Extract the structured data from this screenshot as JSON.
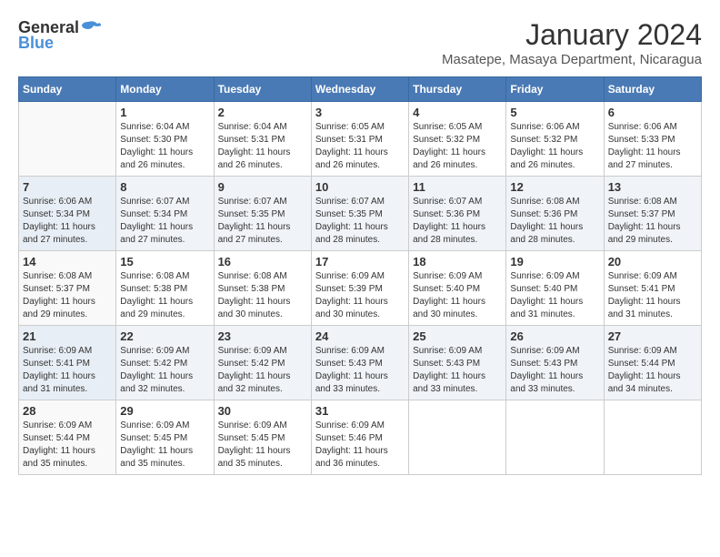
{
  "logo": {
    "general": "General",
    "blue": "Blue"
  },
  "title": "January 2024",
  "location": "Masatepe, Masaya Department, Nicaragua",
  "weekdays": [
    "Sunday",
    "Monday",
    "Tuesday",
    "Wednesday",
    "Thursday",
    "Friday",
    "Saturday"
  ],
  "weeks": [
    [
      {
        "day": "",
        "sunrise": "",
        "sunset": "",
        "daylight": ""
      },
      {
        "day": "1",
        "sunrise": "Sunrise: 6:04 AM",
        "sunset": "Sunset: 5:30 PM",
        "daylight": "Daylight: 11 hours and 26 minutes."
      },
      {
        "day": "2",
        "sunrise": "Sunrise: 6:04 AM",
        "sunset": "Sunset: 5:31 PM",
        "daylight": "Daylight: 11 hours and 26 minutes."
      },
      {
        "day": "3",
        "sunrise": "Sunrise: 6:05 AM",
        "sunset": "Sunset: 5:31 PM",
        "daylight": "Daylight: 11 hours and 26 minutes."
      },
      {
        "day": "4",
        "sunrise": "Sunrise: 6:05 AM",
        "sunset": "Sunset: 5:32 PM",
        "daylight": "Daylight: 11 hours and 26 minutes."
      },
      {
        "day": "5",
        "sunrise": "Sunrise: 6:06 AM",
        "sunset": "Sunset: 5:32 PM",
        "daylight": "Daylight: 11 hours and 26 minutes."
      },
      {
        "day": "6",
        "sunrise": "Sunrise: 6:06 AM",
        "sunset": "Sunset: 5:33 PM",
        "daylight": "Daylight: 11 hours and 27 minutes."
      }
    ],
    [
      {
        "day": "7",
        "sunrise": "Sunrise: 6:06 AM",
        "sunset": "Sunset: 5:34 PM",
        "daylight": "Daylight: 11 hours and 27 minutes."
      },
      {
        "day": "8",
        "sunrise": "Sunrise: 6:07 AM",
        "sunset": "Sunset: 5:34 PM",
        "daylight": "Daylight: 11 hours and 27 minutes."
      },
      {
        "day": "9",
        "sunrise": "Sunrise: 6:07 AM",
        "sunset": "Sunset: 5:35 PM",
        "daylight": "Daylight: 11 hours and 27 minutes."
      },
      {
        "day": "10",
        "sunrise": "Sunrise: 6:07 AM",
        "sunset": "Sunset: 5:35 PM",
        "daylight": "Daylight: 11 hours and 28 minutes."
      },
      {
        "day": "11",
        "sunrise": "Sunrise: 6:07 AM",
        "sunset": "Sunset: 5:36 PM",
        "daylight": "Daylight: 11 hours and 28 minutes."
      },
      {
        "day": "12",
        "sunrise": "Sunrise: 6:08 AM",
        "sunset": "Sunset: 5:36 PM",
        "daylight": "Daylight: 11 hours and 28 minutes."
      },
      {
        "day": "13",
        "sunrise": "Sunrise: 6:08 AM",
        "sunset": "Sunset: 5:37 PM",
        "daylight": "Daylight: 11 hours and 29 minutes."
      }
    ],
    [
      {
        "day": "14",
        "sunrise": "Sunrise: 6:08 AM",
        "sunset": "Sunset: 5:37 PM",
        "daylight": "Daylight: 11 hours and 29 minutes."
      },
      {
        "day": "15",
        "sunrise": "Sunrise: 6:08 AM",
        "sunset": "Sunset: 5:38 PM",
        "daylight": "Daylight: 11 hours and 29 minutes."
      },
      {
        "day": "16",
        "sunrise": "Sunrise: 6:08 AM",
        "sunset": "Sunset: 5:38 PM",
        "daylight": "Daylight: 11 hours and 30 minutes."
      },
      {
        "day": "17",
        "sunrise": "Sunrise: 6:09 AM",
        "sunset": "Sunset: 5:39 PM",
        "daylight": "Daylight: 11 hours and 30 minutes."
      },
      {
        "day": "18",
        "sunrise": "Sunrise: 6:09 AM",
        "sunset": "Sunset: 5:40 PM",
        "daylight": "Daylight: 11 hours and 30 minutes."
      },
      {
        "day": "19",
        "sunrise": "Sunrise: 6:09 AM",
        "sunset": "Sunset: 5:40 PM",
        "daylight": "Daylight: 11 hours and 31 minutes."
      },
      {
        "day": "20",
        "sunrise": "Sunrise: 6:09 AM",
        "sunset": "Sunset: 5:41 PM",
        "daylight": "Daylight: 11 hours and 31 minutes."
      }
    ],
    [
      {
        "day": "21",
        "sunrise": "Sunrise: 6:09 AM",
        "sunset": "Sunset: 5:41 PM",
        "daylight": "Daylight: 11 hours and 31 minutes."
      },
      {
        "day": "22",
        "sunrise": "Sunrise: 6:09 AM",
        "sunset": "Sunset: 5:42 PM",
        "daylight": "Daylight: 11 hours and 32 minutes."
      },
      {
        "day": "23",
        "sunrise": "Sunrise: 6:09 AM",
        "sunset": "Sunset: 5:42 PM",
        "daylight": "Daylight: 11 hours and 32 minutes."
      },
      {
        "day": "24",
        "sunrise": "Sunrise: 6:09 AM",
        "sunset": "Sunset: 5:43 PM",
        "daylight": "Daylight: 11 hours and 33 minutes."
      },
      {
        "day": "25",
        "sunrise": "Sunrise: 6:09 AM",
        "sunset": "Sunset: 5:43 PM",
        "daylight": "Daylight: 11 hours and 33 minutes."
      },
      {
        "day": "26",
        "sunrise": "Sunrise: 6:09 AM",
        "sunset": "Sunset: 5:43 PM",
        "daylight": "Daylight: 11 hours and 33 minutes."
      },
      {
        "day": "27",
        "sunrise": "Sunrise: 6:09 AM",
        "sunset": "Sunset: 5:44 PM",
        "daylight": "Daylight: 11 hours and 34 minutes."
      }
    ],
    [
      {
        "day": "28",
        "sunrise": "Sunrise: 6:09 AM",
        "sunset": "Sunset: 5:44 PM",
        "daylight": "Daylight: 11 hours and 35 minutes."
      },
      {
        "day": "29",
        "sunrise": "Sunrise: 6:09 AM",
        "sunset": "Sunset: 5:45 PM",
        "daylight": "Daylight: 11 hours and 35 minutes."
      },
      {
        "day": "30",
        "sunrise": "Sunrise: 6:09 AM",
        "sunset": "Sunset: 5:45 PM",
        "daylight": "Daylight: 11 hours and 35 minutes."
      },
      {
        "day": "31",
        "sunrise": "Sunrise: 6:09 AM",
        "sunset": "Sunset: 5:46 PM",
        "daylight": "Daylight: 11 hours and 36 minutes."
      },
      {
        "day": "",
        "sunrise": "",
        "sunset": "",
        "daylight": ""
      },
      {
        "day": "",
        "sunrise": "",
        "sunset": "",
        "daylight": ""
      },
      {
        "day": "",
        "sunrise": "",
        "sunset": "",
        "daylight": ""
      }
    ]
  ]
}
